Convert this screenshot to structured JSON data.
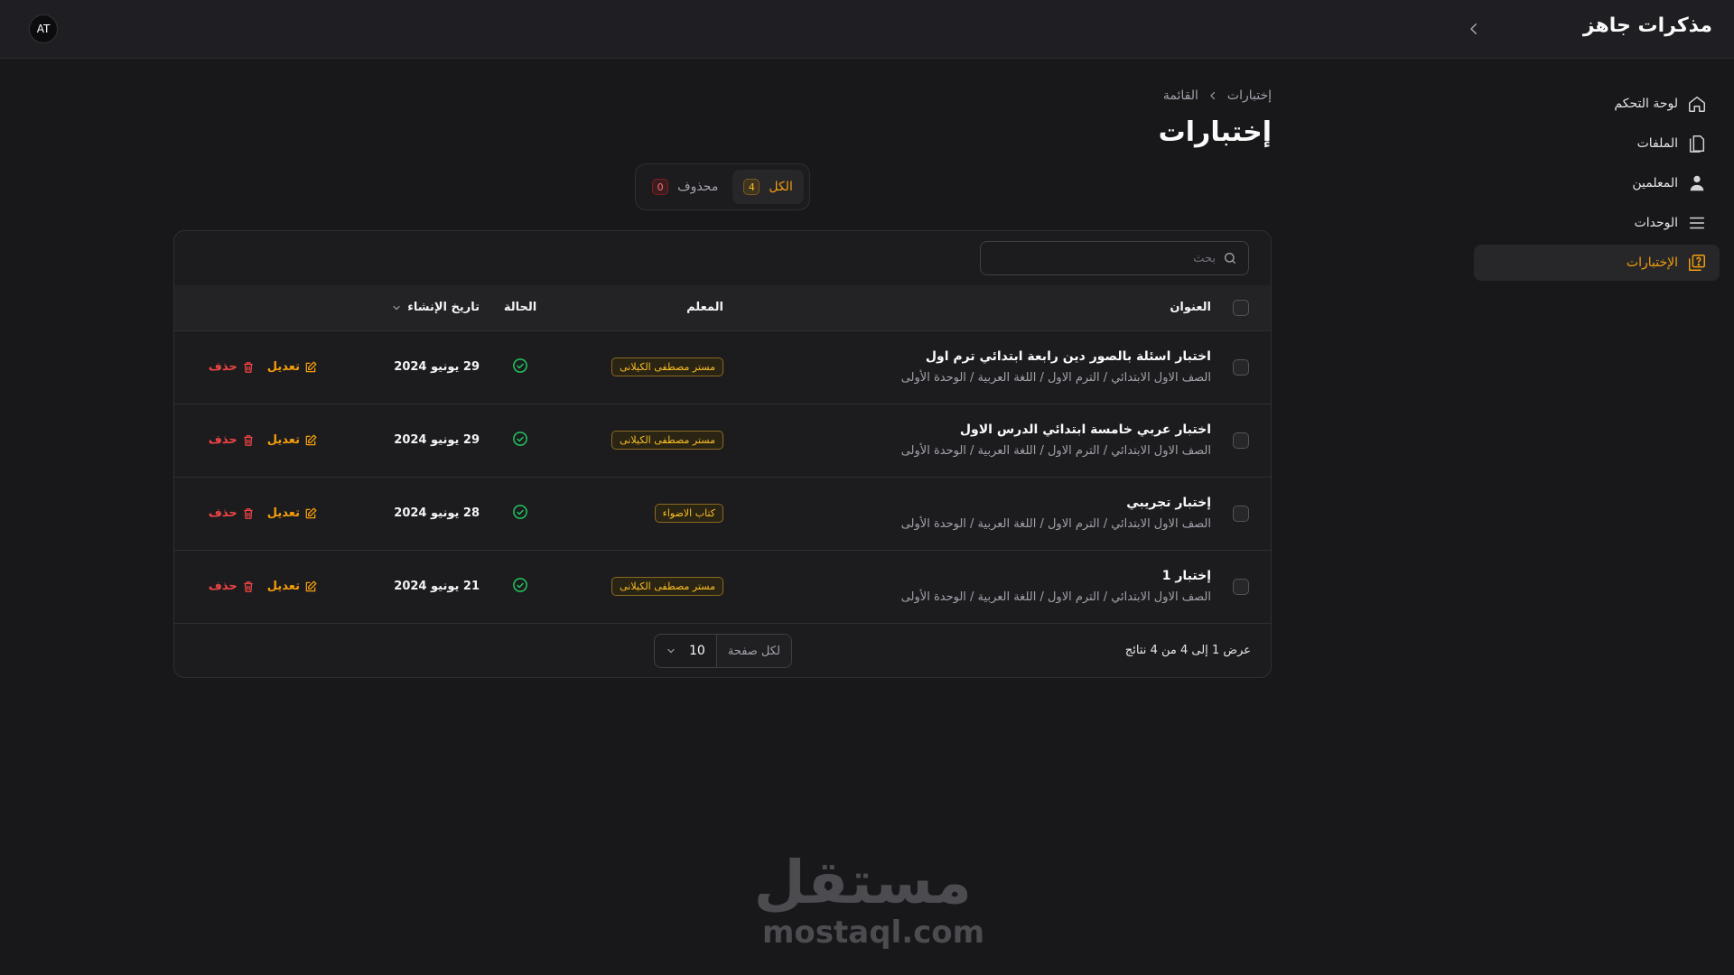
{
  "app": {
    "brand": "مذكرات جاهز",
    "avatar_initials": "AT"
  },
  "sidebar": {
    "items": [
      {
        "label": "لوحة التحكم",
        "icon": "home-icon",
        "active": false
      },
      {
        "label": "الملفات",
        "icon": "file-icon",
        "active": false
      },
      {
        "label": "المعلمين",
        "icon": "user-icon",
        "active": false
      },
      {
        "label": "الوحدات",
        "icon": "list-icon",
        "active": false
      },
      {
        "label": "الإختبارات",
        "icon": "quiz-icon",
        "active": true
      }
    ]
  },
  "breadcrumb": {
    "parent": "إختبارات",
    "current": "القائمة"
  },
  "page": {
    "title": "إختبارات"
  },
  "tabs": [
    {
      "label": "الكل",
      "count": "4",
      "active": true
    },
    {
      "label": "محذوف",
      "count": "0",
      "active": false
    }
  ],
  "search": {
    "placeholder": "بحث",
    "value": ""
  },
  "table": {
    "headers": {
      "title": "العنوان",
      "teacher": "المعلم",
      "status": "الحالة",
      "date": "تاريخ الإنشاء"
    },
    "rows": [
      {
        "title": "اختبار اسئلة بالصور دين رابعة ابتدائي ترم اول",
        "path": "الصف الاول الابتدائي / الترم الاول / اللغة العربية / الوحدة الأولى",
        "teacher": "مستر مصطفى الكيلانى",
        "status": "active",
        "date": "29 يونيو 2024"
      },
      {
        "title": "اختبار عربي خامسة ابتدائي الدرس الاول",
        "path": "الصف الاول الابتدائي / الترم الاول / اللغة العربية / الوحدة الأولى",
        "teacher": "مستر مصطفى الكيلانى",
        "status": "active",
        "date": "29 يونيو 2024"
      },
      {
        "title": "إختبار تجريبي",
        "path": "الصف الاول الابتدائي / الترم الاول / اللغة العربية / الوحدة الأولى",
        "teacher": "كتاب الاضواء",
        "status": "active",
        "date": "28 يونيو 2024"
      },
      {
        "title": "إختبار 1",
        "path": "الصف الاول الابتدائي / الترم الاول / اللغة العربية / الوحدة الأولى",
        "teacher": "مستر مصطفى الكيلانى",
        "status": "active",
        "date": "21 يونيو 2024"
      }
    ],
    "actions": {
      "edit": "تعديل",
      "delete": "حذف"
    }
  },
  "footer": {
    "results_text": "عرض 1 إلى 4 من 4 نتائج",
    "per_page_label": "لكل صفحة",
    "per_page_value": "10"
  },
  "watermark": {
    "arabic": "مستقل",
    "latin": "mostaql.com"
  },
  "colors": {
    "accent": "#f59e0b",
    "danger": "#ef4444",
    "success": "#22c55e",
    "background": "#18181b"
  }
}
